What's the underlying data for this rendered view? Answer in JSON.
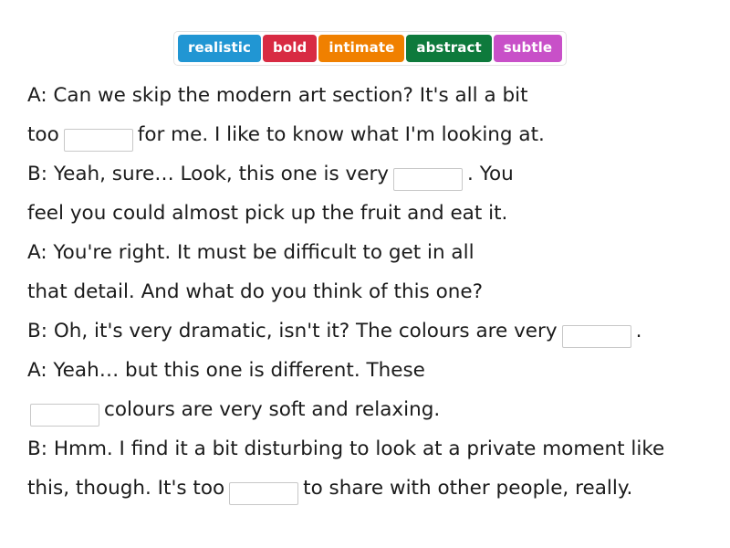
{
  "wordbank": {
    "name": "word-bank",
    "options": [
      {
        "label": "realistic",
        "color": "#2196d3"
      },
      {
        "label": "bold",
        "color": "#d82b43"
      },
      {
        "label": "intimate",
        "color": "#f08000"
      },
      {
        "label": "abstract",
        "color": "#0e7a3c"
      },
      {
        "label": "subtle",
        "color": "#c850c8"
      }
    ]
  },
  "dialogue": {
    "lines": [
      {
        "id": "line-1",
        "segments": [
          {
            "type": "text",
            "value": "A: Can we skip the modern art section? It's all a bit"
          }
        ]
      },
      {
        "id": "line-2",
        "segments": [
          {
            "type": "text",
            "value": "too"
          },
          {
            "type": "blank",
            "value": "",
            "placeholder": ""
          },
          {
            "type": "text",
            "value": "for me. I like to know what I'm looking at."
          }
        ]
      },
      {
        "id": "line-3",
        "segments": [
          {
            "type": "text",
            "value": "B: Yeah, sure… Look, this one is very"
          },
          {
            "type": "blank",
            "value": "",
            "placeholder": ""
          },
          {
            "type": "text",
            "value": ". You"
          }
        ]
      },
      {
        "id": "line-4",
        "segments": [
          {
            "type": "text",
            "value": "feel you could almost pick up the fruit and eat it."
          }
        ]
      },
      {
        "id": "line-5",
        "segments": [
          {
            "type": "text",
            "value": "A: You're right. It must be difficult to get in all"
          }
        ]
      },
      {
        "id": "line-6",
        "segments": [
          {
            "type": "text",
            "value": "that detail. And what do you think of this one?"
          }
        ]
      },
      {
        "id": "line-7",
        "segments": [
          {
            "type": "text",
            "value": "B: Oh, it's very dramatic, isn't it? The colours are very"
          },
          {
            "type": "blank",
            "value": "",
            "placeholder": ""
          },
          {
            "type": "text",
            "value": "."
          }
        ]
      },
      {
        "id": "line-8",
        "segments": [
          {
            "type": "text",
            "value": "A: Yeah… but this one is different. These"
          }
        ]
      },
      {
        "id": "line-9",
        "indent": true,
        "segments": [
          {
            "type": "blank",
            "value": "",
            "placeholder": ""
          },
          {
            "type": "text",
            "value": "colours are very soft and relaxing."
          }
        ]
      },
      {
        "id": "line-10",
        "segments": [
          {
            "type": "text",
            "value": "B: Hmm. I find it a bit disturbing to look at a private moment like"
          }
        ]
      },
      {
        "id": "line-11",
        "segments": [
          {
            "type": "text",
            "value": "this, though. It's too"
          },
          {
            "type": "blank",
            "value": "",
            "placeholder": ""
          },
          {
            "type": "text",
            "value": "to share with other people, really."
          }
        ]
      }
    ]
  }
}
